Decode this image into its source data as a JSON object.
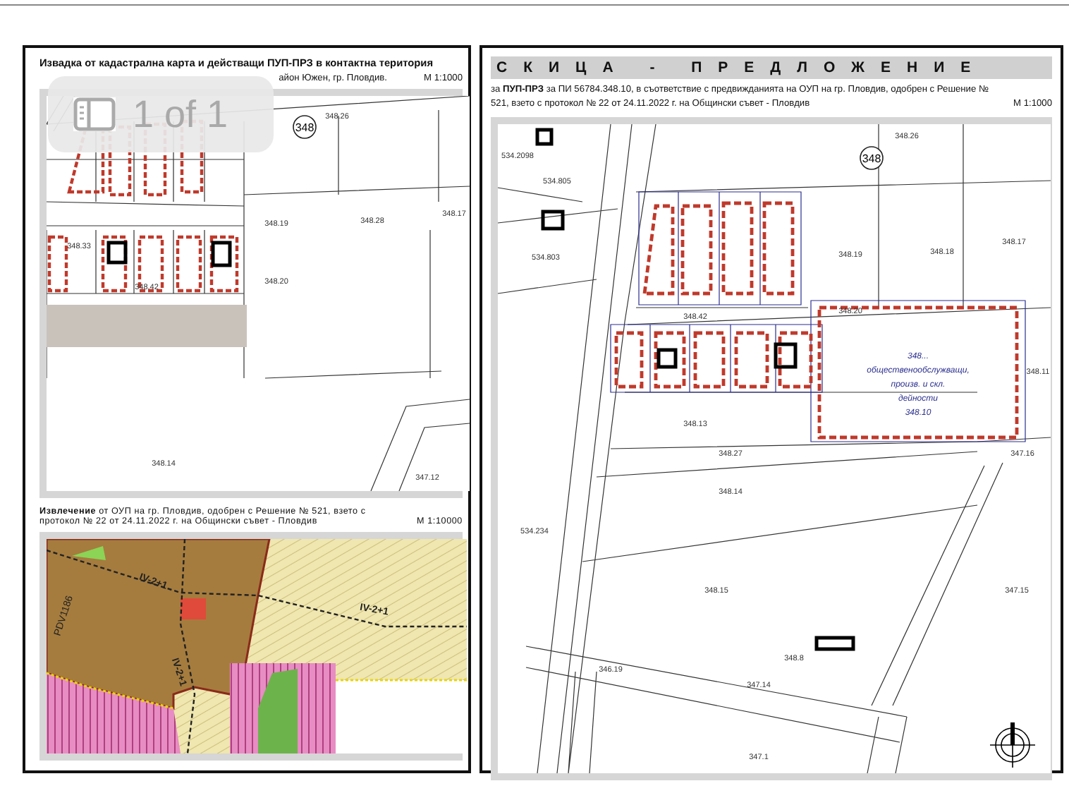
{
  "viewer_badge": {
    "text": "1 of 1"
  },
  "left_panel": {
    "title": "Извадка от кадастрална карта и действащи ПУП-ПРЗ в контактна територия",
    "subtitle": "айон Южен, гр. Пловдив.",
    "scale": "М 1:1000",
    "map": {
      "zone_mark": "348",
      "labels": [
        "348.26",
        "348.19",
        "348.28",
        "348.17",
        "348.33",
        "348.42",
        "348.20",
        "348.14",
        "347.12"
      ]
    },
    "extract": {
      "description": "**Извлечение** от ОУП на гр. Пловдив,  одобрен с Решение № 521, взето с протокол № 22  от 24.11.2022 г. на Общински съвет - Пловдив",
      "scale": "М 1:10000",
      "labels": [
        "IV-2+1",
        "IV-2+1",
        "IV-2+1",
        "PDV1186"
      ]
    }
  },
  "right_panel": {
    "title": "СКИЦА - ПРЕДЛОЖЕНИЕ",
    "description": "за **ПУП-ПРЗ** за ПИ 56784.348.10, в съответствие с предвижданията на ОУП на гр. Пловдив, одобрен с Решение № 521, взето с протокол № 22  от 24.11.2022 г. на Общински съвет - Пловдив",
    "scale": "М 1:1000",
    "map": {
      "zone_mark": "348",
      "labels": [
        "348.26",
        "534.2098",
        "534.805",
        "534.803",
        "348.19",
        "348.18",
        "348.17",
        "348.42",
        "348.20",
        "348.11",
        "348.13",
        "348.27",
        "347.16",
        "348.14",
        "534.234",
        "348.15",
        "347.15",
        "346.19",
        "348.8",
        "347.14",
        "347.1"
      ],
      "block_lines": [
        "348...",
        "общественообслужващи,",
        "произв. и скл.",
        "дейности",
        "348.10"
      ]
    }
  }
}
